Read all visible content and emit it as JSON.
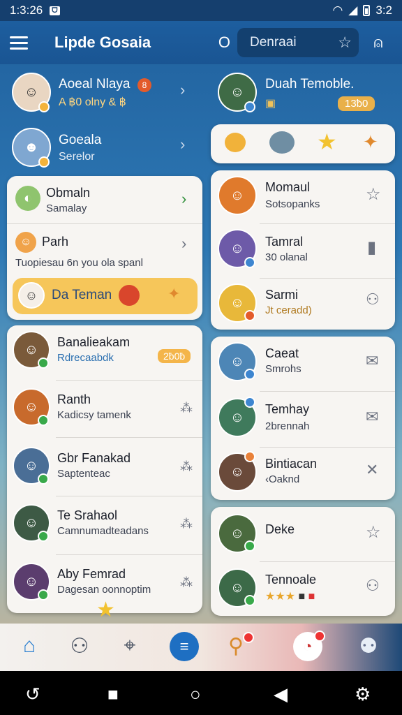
{
  "status": {
    "time": "1:3:26",
    "badge": "ᗜ",
    "right": "3:2"
  },
  "appbar": {
    "title": "Lipde Gosaia",
    "search_o": "O",
    "search_text": "Denraai"
  },
  "left_top": [
    {
      "name": "Aoeal Nlaya",
      "sub": "A ฿0 olny & ฿",
      "badge": "8"
    },
    {
      "name": "Goeala",
      "sub": "Serelor"
    }
  ],
  "left_card1": [
    {
      "title": "Obmaln",
      "sub": "Samalay"
    },
    {
      "title": "Parh",
      "sub": "Tuopiesau 6n you ola spanl"
    }
  ],
  "banner": {
    "label": "Da Teman"
  },
  "left_list": [
    {
      "title": "Banalieakam",
      "sub": "Rdrecaabdk",
      "tag": "2ƀ0ƀ"
    },
    {
      "title": "Ranth",
      "sub": "Kadicsy tamenk"
    },
    {
      "title": "Gbr Fanakad",
      "sub": "Saptenteac"
    },
    {
      "title": "Te Srahaol",
      "sub": "Camnumadteadans"
    },
    {
      "title": "Aby Femrad",
      "sub": "Dagesan oonnoptim"
    }
  ],
  "right_top": {
    "name": "Duah Temoble.",
    "badge": "13ƀ0"
  },
  "right_card1": [
    {
      "title": "Momaul",
      "sub": "Sotsopanks"
    },
    {
      "title": "Tamral",
      "sub": "30 olanal"
    },
    {
      "title": "Sarmi",
      "sub": "Jt ceradd)"
    }
  ],
  "right_card2": [
    {
      "title": "Caeat",
      "sub": "Smrohs"
    },
    {
      "title": "Temhay",
      "sub": "2brennah"
    },
    {
      "title": "Bintiacan",
      "sub": "‹Oaknd"
    }
  ],
  "right_card3": [
    {
      "title": "Deke",
      "sub": ""
    },
    {
      "title": "Tennoale",
      "sub": ""
    }
  ],
  "colors": {
    "accent": "#1d5e9f",
    "banner": "#f6c65a",
    "badge": "#f4b54a"
  }
}
